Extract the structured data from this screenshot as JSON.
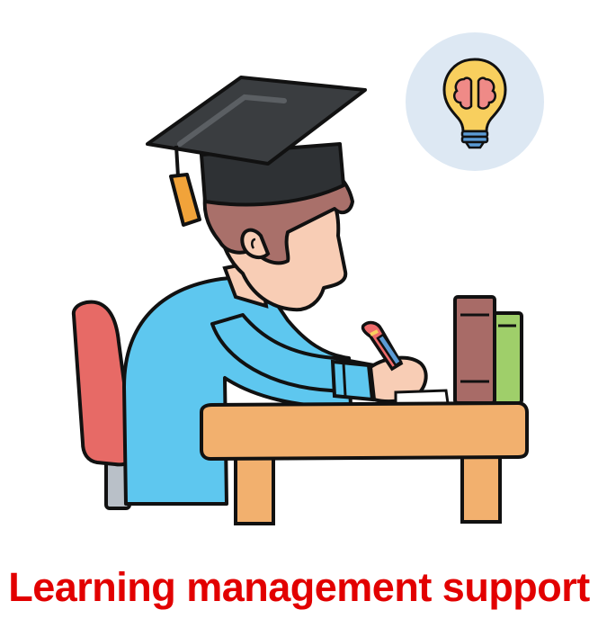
{
  "caption": {
    "text": "Learning management support",
    "color": "#e20000"
  },
  "illustration": {
    "subject": "graduate-student-writing-at-desk",
    "badge_icon": "brain-lightbulb-icon",
    "colors": {
      "outline": "#111111",
      "skin": "#f8cdb5",
      "hair": "#a9706a",
      "shirt": "#5ec7ef",
      "desk": "#f2b06e",
      "chair": "#e76a66",
      "cap": "#3a3d40",
      "tassel": "#f1a33a",
      "book_brown": "#a86b67",
      "book_green": "#9fcf6a",
      "badge_bg": "#dde8f3",
      "bulb": "#f8cf5e",
      "brain": "#ef8a87"
    }
  }
}
